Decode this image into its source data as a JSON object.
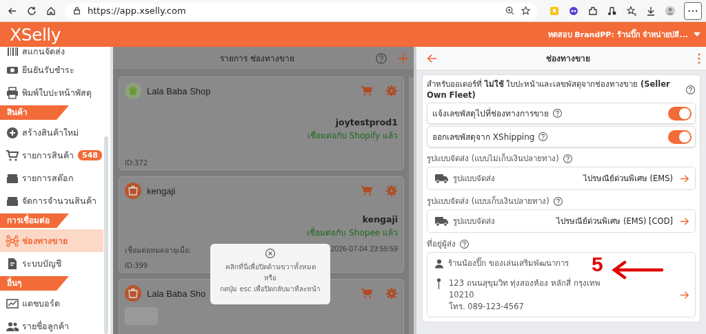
{
  "browser": {
    "url": "https://app.xselly.com"
  },
  "app": {
    "brand": "XSelly",
    "account": "ทดสอบ BrandPP: ร้านปิ๊ก จำหน่ายปลี..."
  },
  "sidebar": {
    "items": [
      {
        "kind": "item",
        "label": "สแกนจัดส่ง",
        "selected": false
      },
      {
        "kind": "item",
        "label": "ยืนยันรับชำระ",
        "selected": false
      },
      {
        "kind": "item",
        "label": "พิมพ์ใบปะหน้าพัสดุ",
        "selected": false
      },
      {
        "kind": "section",
        "label": "สินค้า"
      },
      {
        "kind": "item",
        "label": "สร้างสินค้าใหม่",
        "selected": false
      },
      {
        "kind": "item",
        "label": "รายการสินค้า",
        "badge": "548",
        "selected": false
      },
      {
        "kind": "item",
        "label": "รายการสต๊อก",
        "selected": false
      },
      {
        "kind": "item",
        "label": "จัดการจำนวนสินค้า",
        "selected": false
      },
      {
        "kind": "section",
        "label": "การเชื่อมต่อ"
      },
      {
        "kind": "item",
        "label": "ช่องทางขาย",
        "selected": true
      },
      {
        "kind": "item",
        "label": "ระบบบัญชี",
        "selected": false
      },
      {
        "kind": "section",
        "label": "อื่นๆ"
      },
      {
        "kind": "item",
        "label": "แดชบอร์ด",
        "selected": false
      },
      {
        "kind": "item",
        "label": "รายชื่อลูกค้า",
        "selected": false
      }
    ]
  },
  "channel_list": {
    "title": "รายการ ช่องทางขาย",
    "channels": [
      {
        "kind": "shopify",
        "name": "Lala Baba Shop",
        "account": "joytestprod1",
        "status": "เชื่อมต่อกับ Shopify แล้ว",
        "id": "ID:372"
      },
      {
        "kind": "shopee",
        "name": "kengaji",
        "account": "kengaji",
        "status": "เชื่อมต่อกับ Shopee แล้ว",
        "expiry_label": "เชื่อมต่อหมดอายุเมื่อ:",
        "expiry": "2026-07-04 23:59:59",
        "id": "ID:399"
      },
      {
        "kind": "shopee",
        "name": "Lala Baba Sho"
      }
    ]
  },
  "hint": {
    "lines": [
      "คลิกที่นี่เพื่อปิดด้านขวาทั้งหมด",
      "หรือ",
      "กดปุ่ม esc เพื่อปิดกลับมาทีละหน้า"
    ]
  },
  "detail": {
    "title": "ช่องทางขาย",
    "note": "สำหรับออเดอร์ที่ **ไม่ใช้** ใบปะหน้าและเลขพัสดุจากช่องทางขาย **(Seller Own Fleet)**",
    "toggles": [
      {
        "label": "แจ้งเลขพัสดุไปที่ช่องทางการขาย",
        "on": true
      },
      {
        "label": "ออกเลขพัสดุจาก XShipping",
        "on": true
      }
    ],
    "shipping": [
      {
        "heading": "รูปแบบจัดส่ง (แบบไม่เก็บเงินปลายทาง)",
        "label": "รูปแบบจัดส่ง",
        "value": "ไปรษณีย์ด่วนพิเศษ (EMS)"
      },
      {
        "heading": "รูปแบบจัดส่ง (แบบเก็บเงินปลายทาง)",
        "label": "รูปแบบจัดส่ง",
        "value": "ไปรษณีย์ด่วนพิเศษ (EMS) [COD]"
      }
    ],
    "sender": {
      "heading": "ที่อยู่ผู้ส่ง",
      "name": "ร้านน้องปิ๊ก ของเล่นเสริมพัฒนาการ",
      "address": "123 ถนนสุขุมวิท ทุ่งสองห้อง หลักสี่ กรุงเทพ",
      "postcode": "10210",
      "phone": "โทร. 089-123-4567"
    }
  },
  "annotation": {
    "number": "5"
  }
}
